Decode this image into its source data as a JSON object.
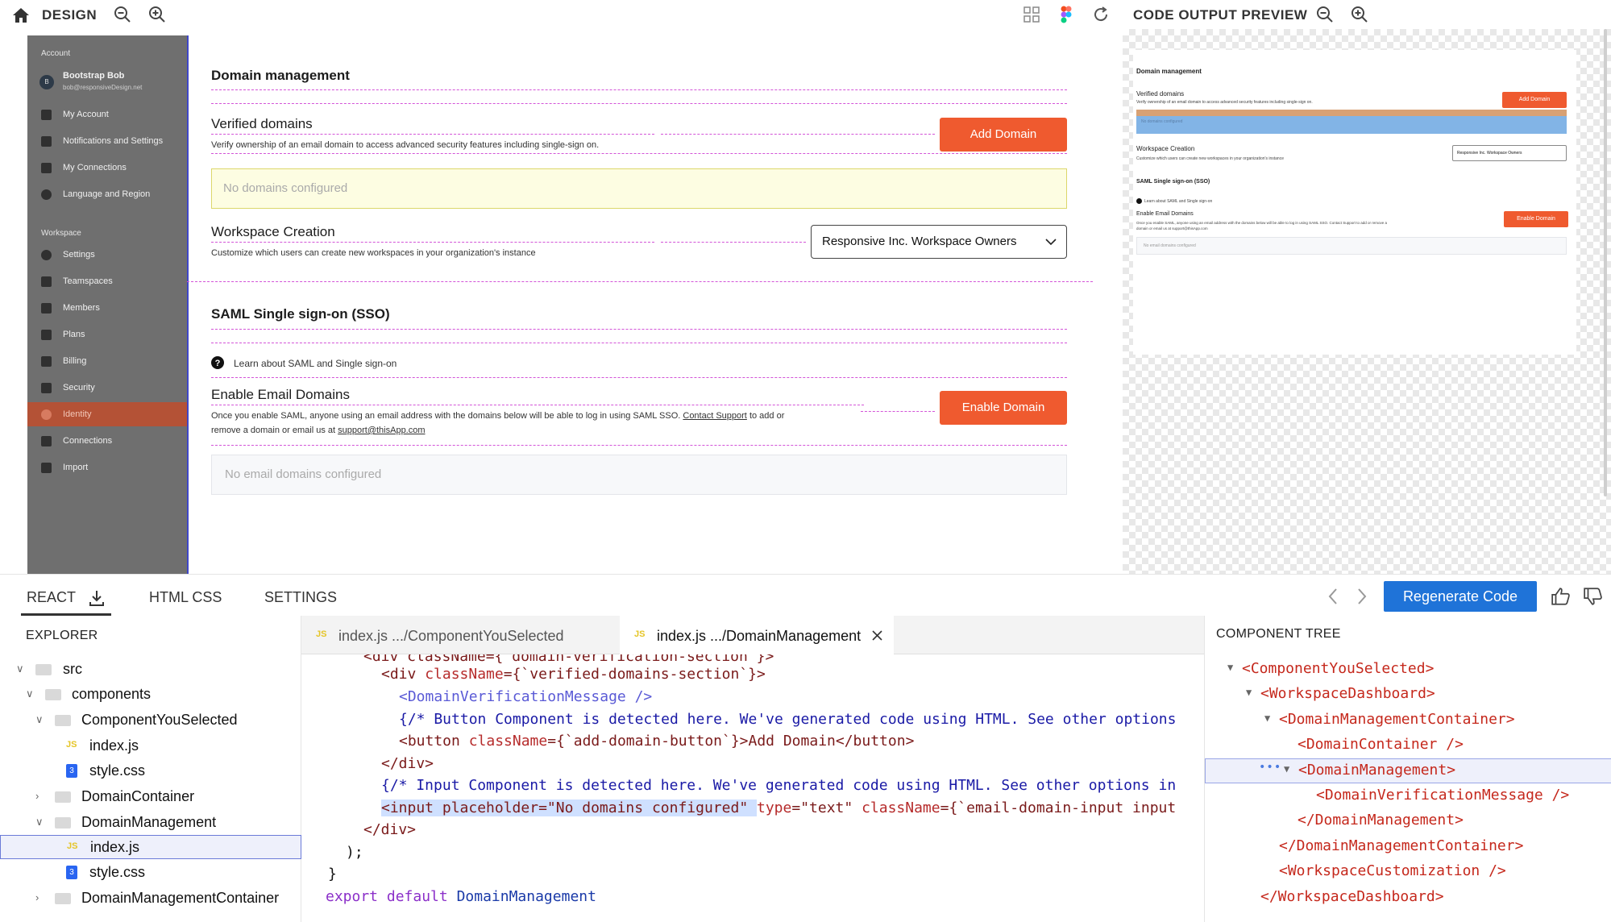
{
  "toolbar": {
    "title": "DESIGN",
    "preview_title": "CODE OUTPUT PREVIEW"
  },
  "sidebar": {
    "account_section": "Account",
    "user_initial": "B",
    "user_name": "Bootstrap Bob",
    "user_email": "bob@responsiveDesign.net",
    "workspace_section": "Workspace",
    "items": [
      {
        "label": "My Account",
        "icon": "user-icon"
      },
      {
        "label": "Notifications and Settings",
        "icon": "bell-icon"
      },
      {
        "label": "My Connections",
        "icon": "link-icon"
      },
      {
        "label": "Language and Region",
        "icon": "globe-icon"
      },
      {
        "label": "Settings",
        "icon": "gear-icon"
      },
      {
        "label": "Teamspaces",
        "icon": "grid-icon"
      },
      {
        "label": "Members",
        "icon": "users-icon"
      },
      {
        "label": "Plans",
        "icon": "book-icon"
      },
      {
        "label": "Billing",
        "icon": "card-icon"
      },
      {
        "label": "Security",
        "icon": "lock-icon"
      },
      {
        "label": "Identity",
        "icon": "shield-icon",
        "active": true
      },
      {
        "label": "Connections",
        "icon": "apps-icon"
      },
      {
        "label": "Import",
        "icon": "import-icon"
      }
    ]
  },
  "panel": {
    "domain_title": "Domain management",
    "verified_title": "Verified domains",
    "verified_desc": "Verify ownership of an email domain to access advanced security features including single-sign on.",
    "add_domain": "Add Domain",
    "no_domains": "No domains configured",
    "workspace_title": "Workspace Creation",
    "workspace_desc": "Customize which users can create new workspaces in your organization's instance",
    "workspace_select": "Responsive Inc. Workspace Owners",
    "saml_title": "SAML Single sign-on (SSO)",
    "learn_saml": "Learn about SAML and Single sign-on",
    "enable_title": "Enable Email Domains",
    "enable_desc_1": "Once you enable SAML, anyone using an email address with the domains below  will be  able to log in using SAML SSO.",
    "contact_support": "Contact Support",
    "enable_desc_2": "to add or",
    "enable_desc_3": "remove a domain or email us at",
    "support_email": "support@thisApp.com",
    "enable_domain": "Enable Domain",
    "no_email_domains": "No email domains configured"
  },
  "preview": {
    "domain_title": "Domain management",
    "verified_title": "Verified domains",
    "verified_desc": "Verify ownership of an email domain to access advanced security features including single-sign on.",
    "add_domain": "Add Domain",
    "no_domains": "No domains configured",
    "workspace_title": "Workspace Creation",
    "workspace_desc": "Customize which users can create new workspaces in your organization's instance",
    "workspace_select": "Responsive Inc. Workspace Owners",
    "saml_title": "SAML Single sign-on (SSO)",
    "learn_saml": "Learn about SAML and Single sign-on",
    "enable_title": "Enable Email Domains",
    "enable_desc": "Once you enable SAML, anyone using an email address with the domains below will be able to log in using SAML SSO. Contact Support to add or remove a",
    "enable_desc_2": "domain or email us at support@thisApp.com",
    "enable_domain": "Enable Domain",
    "no_email_domains": "No email domains configured"
  },
  "bottom_tabs": {
    "react": "REACT",
    "html_css": "HTML CSS",
    "settings": "SETTINGS",
    "regenerate": "Regenerate Code"
  },
  "explorer": {
    "title": "EXPLORER",
    "rows": [
      {
        "label": "src",
        "type": "folder"
      },
      {
        "label": "components",
        "type": "folder"
      },
      {
        "label": "ComponentYouSelected",
        "type": "folder"
      },
      {
        "label": "index.js",
        "type": "js"
      },
      {
        "label": "style.css",
        "type": "css"
      },
      {
        "label": "DomainContainer",
        "type": "folder"
      },
      {
        "label": "DomainManagement",
        "type": "folder"
      },
      {
        "label": "index.js",
        "type": "js",
        "selected": true
      },
      {
        "label": "style.css",
        "type": "css"
      },
      {
        "label": "DomainManagementContainer",
        "type": "folder"
      }
    ]
  },
  "editor": {
    "tab1": "index.js .../ComponentYouSelected",
    "tab2": "index.js .../DomainManagement",
    "js_badge": "JS",
    "lines": {
      "l0": "<div className={`domain-verification-section`}>",
      "l1a": "<div ",
      "l1b": "className",
      "l1c": "={`verified-domains-section`}>",
      "l2": "<DomainVerificationMessage />",
      "l3": "{/* Button Component is detected here. We've generated code using HTML. See other options",
      "l4a": "<button ",
      "l4b": "className",
      "l4c": "={`add-domain-button`}>Add Domain</button>",
      "l5": "</div>",
      "l6": "{/* Input Component is detected here. We've generated code using HTML. See other options in",
      "l7a": "<input placeholder=\"No domains configured\" ",
      "l7b": "type",
      "l7c": "=\"text\" ",
      "l7d": "className",
      "l7e": "={`email-domain-input input",
      "l8": "</div>",
      "l9": ");",
      "l10": "}",
      "l11a": "export default ",
      "l11b": "DomainManagement"
    }
  },
  "component_tree": {
    "title": "COMPONENT TREE",
    "rows": [
      "<ComponentYouSelected>",
      "<WorkspaceDashboard>",
      "<DomainManagementContainer>",
      "<DomainContainer />",
      "<DomainManagement>",
      "<DomainVerificationMessage />",
      "</DomainManagement>",
      "</DomainManagementContainer>",
      "<WorkspaceCustomization />",
      "</WorkspaceDashboard>"
    ],
    "dots": "•••"
  }
}
